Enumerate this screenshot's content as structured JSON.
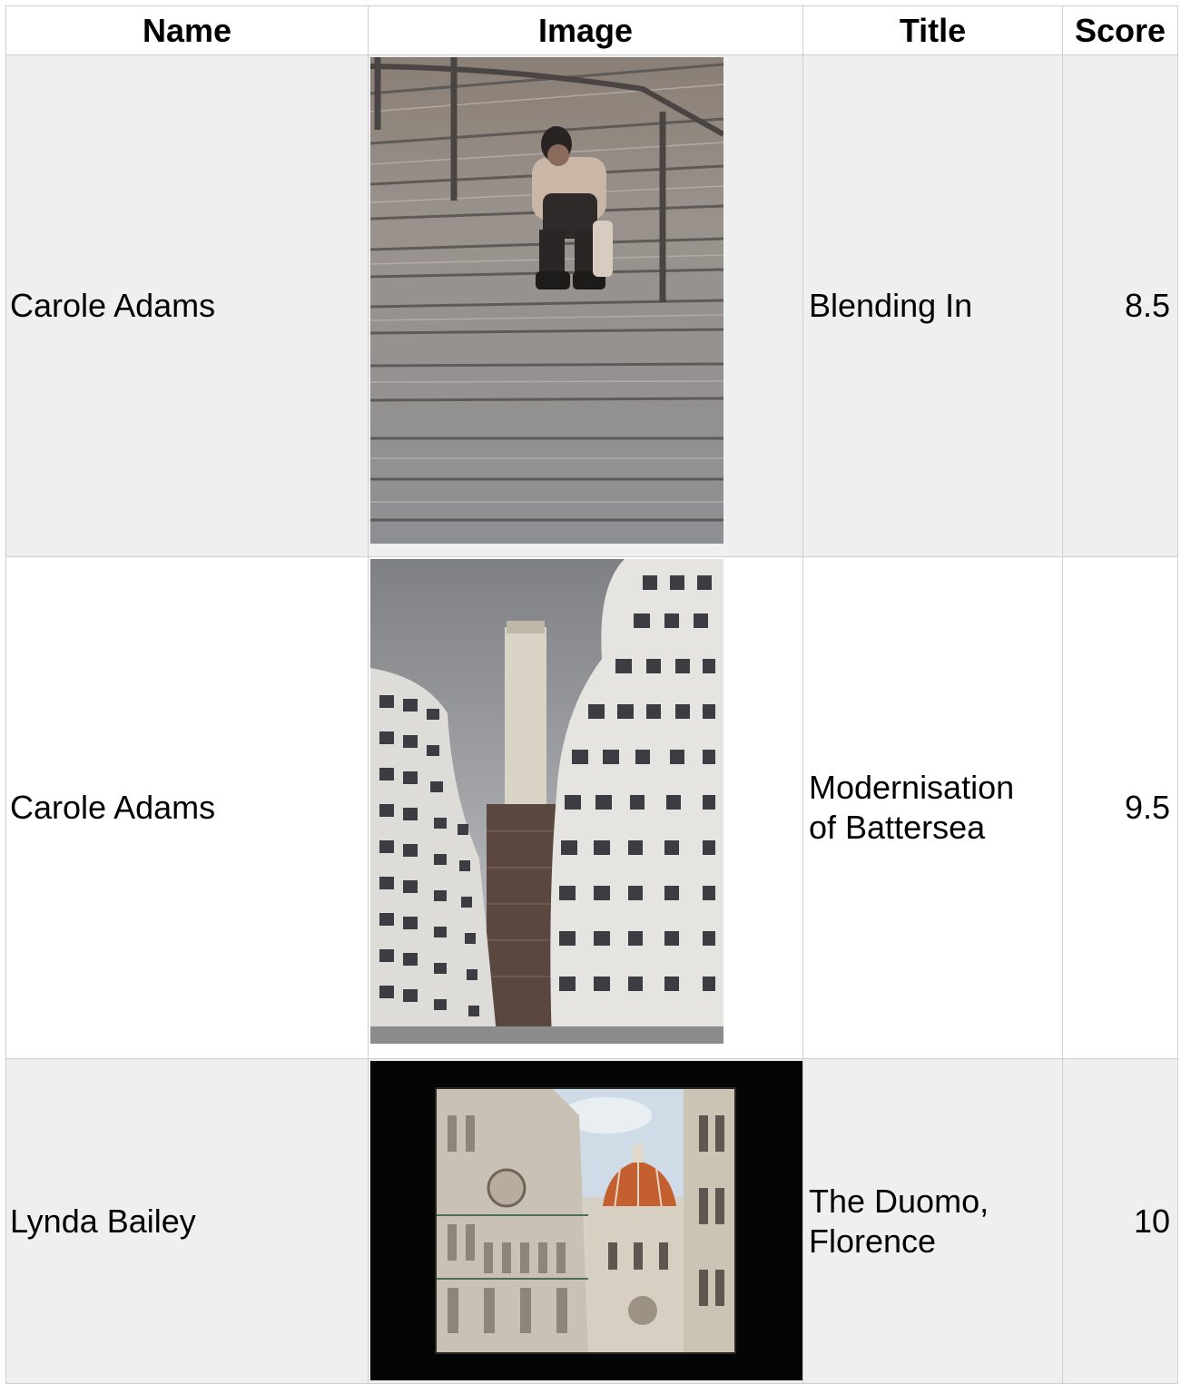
{
  "table": {
    "headers": {
      "name": "Name",
      "image": "Image",
      "title": "Title",
      "score": "Score"
    },
    "rows": [
      {
        "name": "Carole Adams",
        "image_subject": "person sitting on stone steps",
        "title": "Blending In",
        "score": "8.5"
      },
      {
        "name": "Carole Adams",
        "image_subject": "chimney between wavy apartment buildings",
        "title_lines": [
          "Modernisation",
          "of Battersea"
        ],
        "score": "9.5"
      },
      {
        "name": "Lynda Bailey",
        "image_subject": "cathedral facade and dome framed by black border",
        "title_lines": [
          "The Duomo,",
          "Florence"
        ],
        "score": "10"
      }
    ]
  }
}
